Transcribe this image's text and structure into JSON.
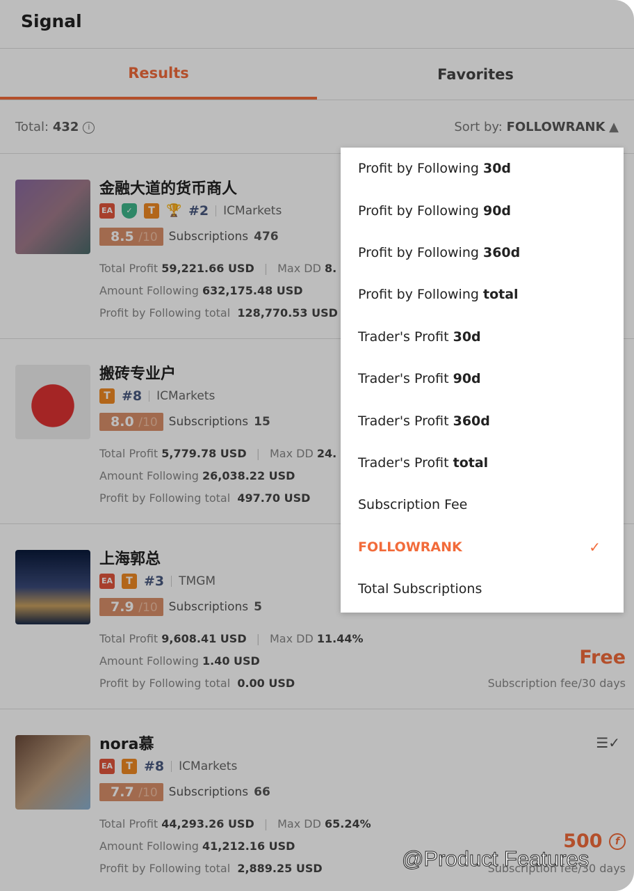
{
  "header": {
    "title": "Signal"
  },
  "tabs": [
    {
      "label": "Results",
      "active": true
    },
    {
      "label": "Favorites",
      "active": false
    }
  ],
  "summary": {
    "total_label": "Total:",
    "total": "432",
    "sort_label": "Sort by:",
    "sort_value": "FOLLOWRANK"
  },
  "accent": "#f26b3a",
  "cards": [
    {
      "name": "金融大道的货币商人",
      "badges": [
        "EA",
        "shield",
        "T",
        "trophy"
      ],
      "rank": "#2",
      "broker": "ICMarkets",
      "score": "8.5",
      "score_max": "/10",
      "subs_label": "Subscriptions",
      "subs": "476",
      "tp_label": "Total Profit",
      "tp": "59,221.66 USD",
      "dd_label": "Max DD",
      "dd": "8.",
      "af_label": "Amount Following",
      "af": "632,175.48 USD",
      "pf_label": "Profit by Following total",
      "pf": "128,770.53 USD"
    },
    {
      "name": "搬砖专业户",
      "badges": [
        "T"
      ],
      "rank": "#8",
      "broker": "ICMarkets",
      "score": "8.0",
      "score_max": "/10",
      "subs_label": "Subscriptions",
      "subs": "15",
      "tp_label": "Total Profit",
      "tp": "5,779.78 USD",
      "dd_label": "Max DD",
      "dd": "24.",
      "af_label": "Amount Following",
      "af": "26,038.22 USD",
      "pf_label": "Profit by Following total",
      "pf": "497.70 USD"
    },
    {
      "name": "上海郭总",
      "badges": [
        "EA",
        "T"
      ],
      "rank": "#3",
      "broker": "TMGM",
      "score": "7.9",
      "score_max": "/10",
      "subs_label": "Subscriptions",
      "subs": "5",
      "tp_label": "Total Profit",
      "tp": "9,608.41 USD",
      "dd_label": "Max DD",
      "dd": "11.44%",
      "af_label": "Amount Following",
      "af": "1.40 USD",
      "pf_label": "Profit by Following total",
      "pf": "0.00 USD",
      "price": "Free",
      "fee_label": "Subscription fee/30 days"
    },
    {
      "name": "nora慕",
      "badges": [
        "EA",
        "T"
      ],
      "rank": "#8",
      "broker": "ICMarkets",
      "score": "7.7",
      "score_max": "/10",
      "subs_label": "Subscriptions",
      "subs": "66",
      "tp_label": "Total Profit",
      "tp": "44,293.26 USD",
      "dd_label": "Max DD",
      "dd": "65.24%",
      "af_label": "Amount Following",
      "af": "41,212.16 USD",
      "pf_label": "Profit by Following total",
      "pf": "2,889.25 USD",
      "price": "500",
      "fee_label": "Subscription fee/30 days"
    }
  ],
  "sort_options": [
    {
      "text": "Profit by Following",
      "bold": "30d"
    },
    {
      "text": "Profit by Following",
      "bold": "90d"
    },
    {
      "text": "Profit by Following",
      "bold": "360d"
    },
    {
      "text": "Profit by Following",
      "bold": "total"
    },
    {
      "text": "Trader's Profit",
      "bold": "30d"
    },
    {
      "text": "Trader's Profit",
      "bold": "90d"
    },
    {
      "text": "Trader's Profit",
      "bold": "360d"
    },
    {
      "text": "Trader's Profit",
      "bold": "total"
    },
    {
      "text": "Subscription Fee",
      "bold": ""
    },
    {
      "text": "FOLLOWRANK",
      "bold": "",
      "selected": true
    },
    {
      "text": "Total Subscriptions",
      "bold": ""
    }
  ],
  "watermark": "@Product Features"
}
